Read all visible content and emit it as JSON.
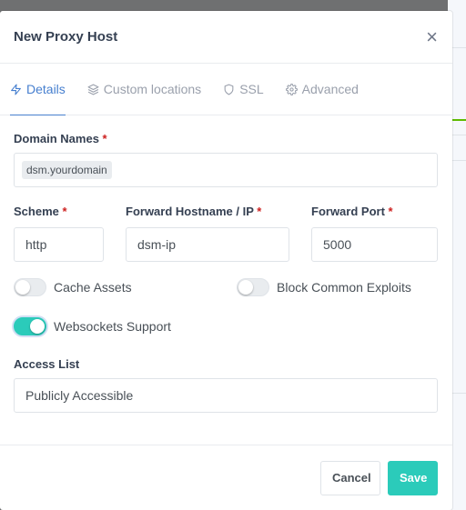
{
  "colors": {
    "accent": "#467fcf",
    "teal": "#2bcbba",
    "required": "#cd201f"
  },
  "modal": {
    "title": "New Proxy Host",
    "close_glyph": "×"
  },
  "tabs": [
    {
      "label": "Details",
      "icon": "bolt-icon",
      "active": true
    },
    {
      "label": "Custom locations",
      "icon": "layers-icon",
      "active": false
    },
    {
      "label": "SSL",
      "icon": "shield-icon",
      "active": false
    },
    {
      "label": "Advanced",
      "icon": "gear-icon",
      "active": false
    }
  ],
  "form": {
    "domain_names": {
      "label": "Domain Names",
      "required_mark": "*",
      "tags": [
        "dsm.yourdomain"
      ]
    },
    "scheme": {
      "label": "Scheme",
      "required_mark": "*",
      "value": "http"
    },
    "forward_host": {
      "label": "Forward Hostname / IP",
      "required_mark": "*",
      "value": "dsm-ip"
    },
    "forward_port": {
      "label": "Forward Port",
      "required_mark": "*",
      "value": "5000"
    },
    "cache_assets": {
      "label": "Cache Assets",
      "checked": false
    },
    "block_exploits": {
      "label": "Block Common Exploits",
      "checked": false
    },
    "websockets": {
      "label": "Websockets Support",
      "checked": true
    },
    "access_list": {
      "label": "Access List",
      "value": "Publicly Accessible"
    }
  },
  "footer": {
    "cancel_label": "Cancel",
    "save_label": "Save"
  }
}
